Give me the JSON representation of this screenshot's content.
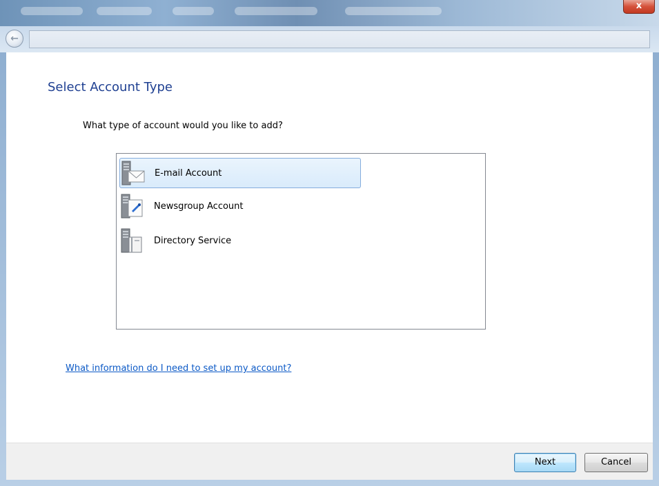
{
  "window": {
    "close_glyph": "x"
  },
  "nav": {
    "back_glyph": "←"
  },
  "wizard": {
    "heading": "Select Account Type",
    "question": "What type of account would you like to add?",
    "account_types": [
      {
        "label": "E-mail Account",
        "icon": "email-account-icon",
        "selected": true
      },
      {
        "label": "Newsgroup Account",
        "icon": "newsgroup-account-icon",
        "selected": false
      },
      {
        "label": "Directory Service",
        "icon": "directory-service-icon",
        "selected": false
      }
    ],
    "help_link": "What information do I need to set up my account?"
  },
  "buttons": {
    "next": "Next",
    "cancel": "Cancel"
  },
  "colors": {
    "heading": "#1e3f91",
    "link": "#0b59c6",
    "selection_border": "#84acdd",
    "close_button": "#c23a22"
  }
}
